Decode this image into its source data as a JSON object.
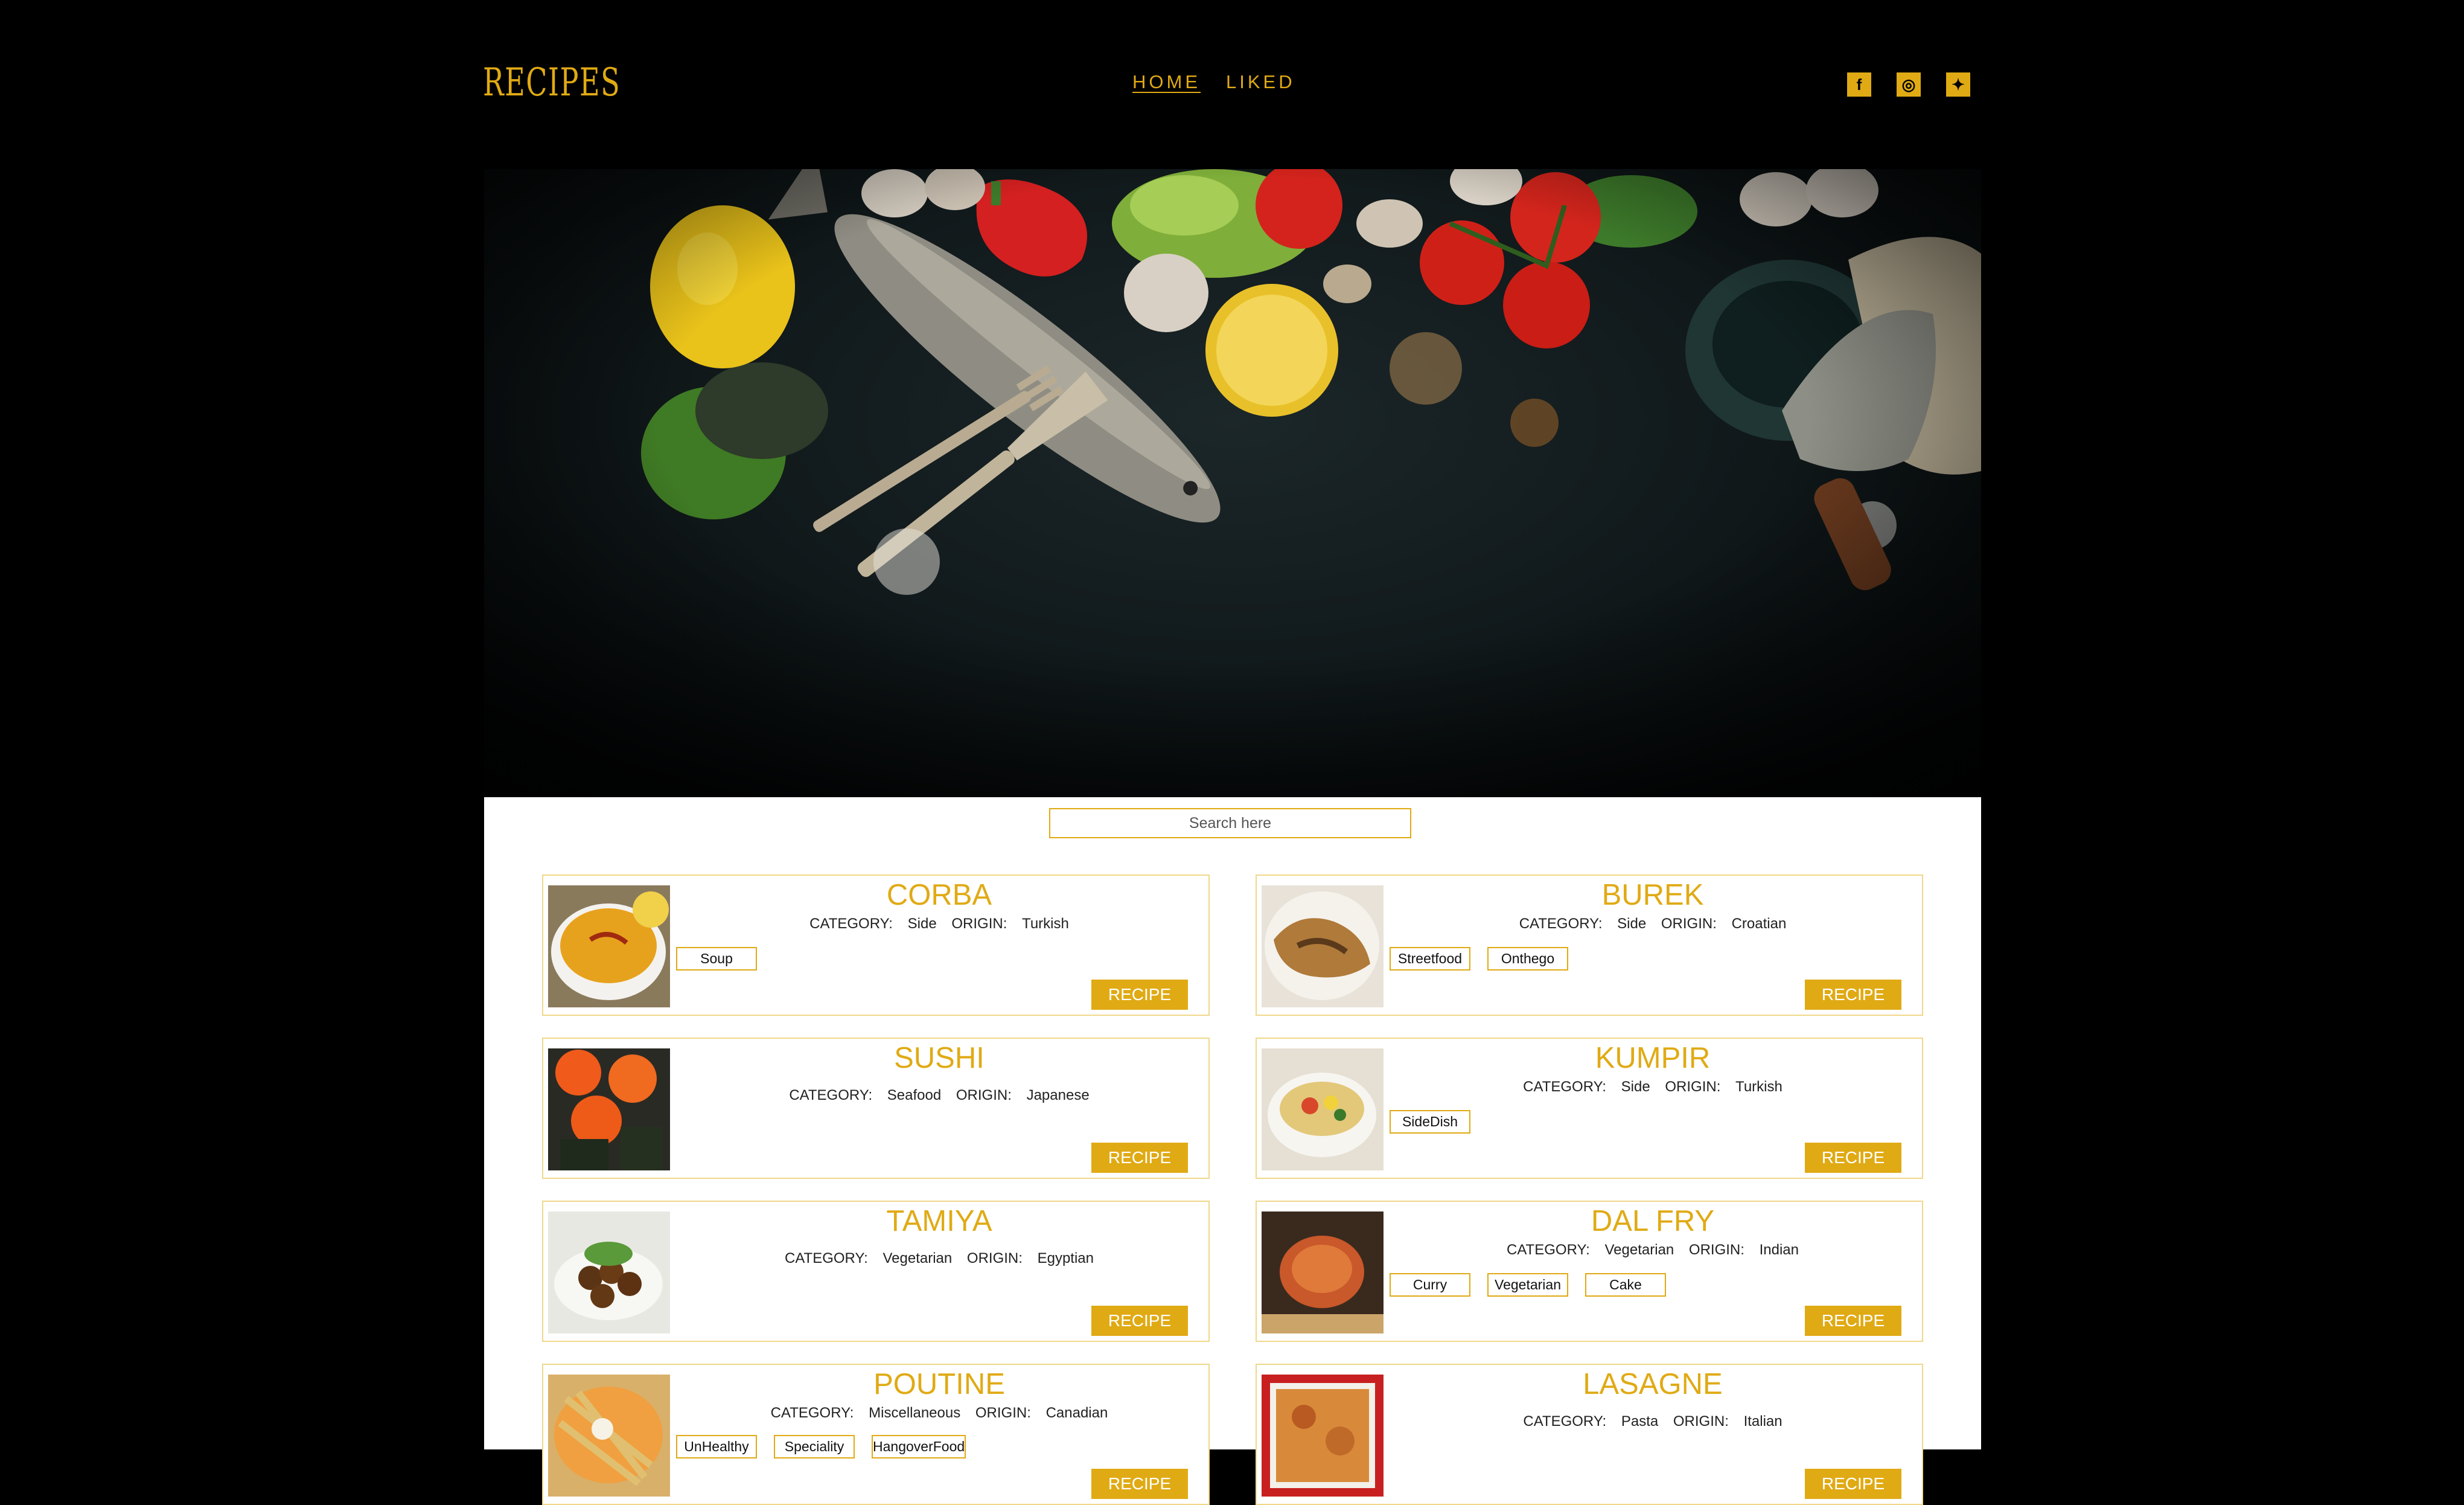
{
  "header": {
    "logo": "RECIPES",
    "nav": [
      {
        "label": "HOME",
        "active": true
      },
      {
        "label": "LIKED",
        "active": false
      }
    ],
    "social": [
      {
        "name": "facebook-icon",
        "glyph": "f"
      },
      {
        "name": "instagram-icon",
        "glyph": "◎"
      },
      {
        "name": "twitter-icon",
        "glyph": "✦"
      }
    ]
  },
  "search": {
    "placeholder": "Search here"
  },
  "recipe_button_label": "RECIPE",
  "category_prefix": "CATEGORY:",
  "origin_prefix": "ORIGIN:",
  "recipes": [
    {
      "name": "CORBA",
      "category": "Side",
      "origin": "Turkish",
      "tags": [
        "Soup"
      ]
    },
    {
      "name": "BUREK",
      "category": "Side",
      "origin": "Croatian",
      "tags": [
        "Streetfood",
        "Onthego"
      ]
    },
    {
      "name": "SUSHI",
      "category": "Seafood",
      "origin": "Japanese",
      "tags": []
    },
    {
      "name": "KUMPIR",
      "category": "Side",
      "origin": "Turkish",
      "tags": [
        "SideDish"
      ]
    },
    {
      "name": "TAMIYA",
      "category": "Vegetarian",
      "origin": "Egyptian",
      "tags": []
    },
    {
      "name": "DAL FRY",
      "category": "Vegetarian",
      "origin": "Indian",
      "tags": [
        "Curry",
        "Vegetarian",
        "Cake"
      ]
    },
    {
      "name": "POUTINE",
      "category": "Miscellaneous",
      "origin": "Canadian",
      "tags": [
        "UnHealthy",
        "Speciality",
        "HangoverFood"
      ]
    },
    {
      "name": "LASAGNE",
      "category": "Pasta",
      "origin": "Italian",
      "tags": []
    }
  ],
  "colors": {
    "accent": "#e0aa14",
    "background": "#000000",
    "content": "#ffffff"
  }
}
